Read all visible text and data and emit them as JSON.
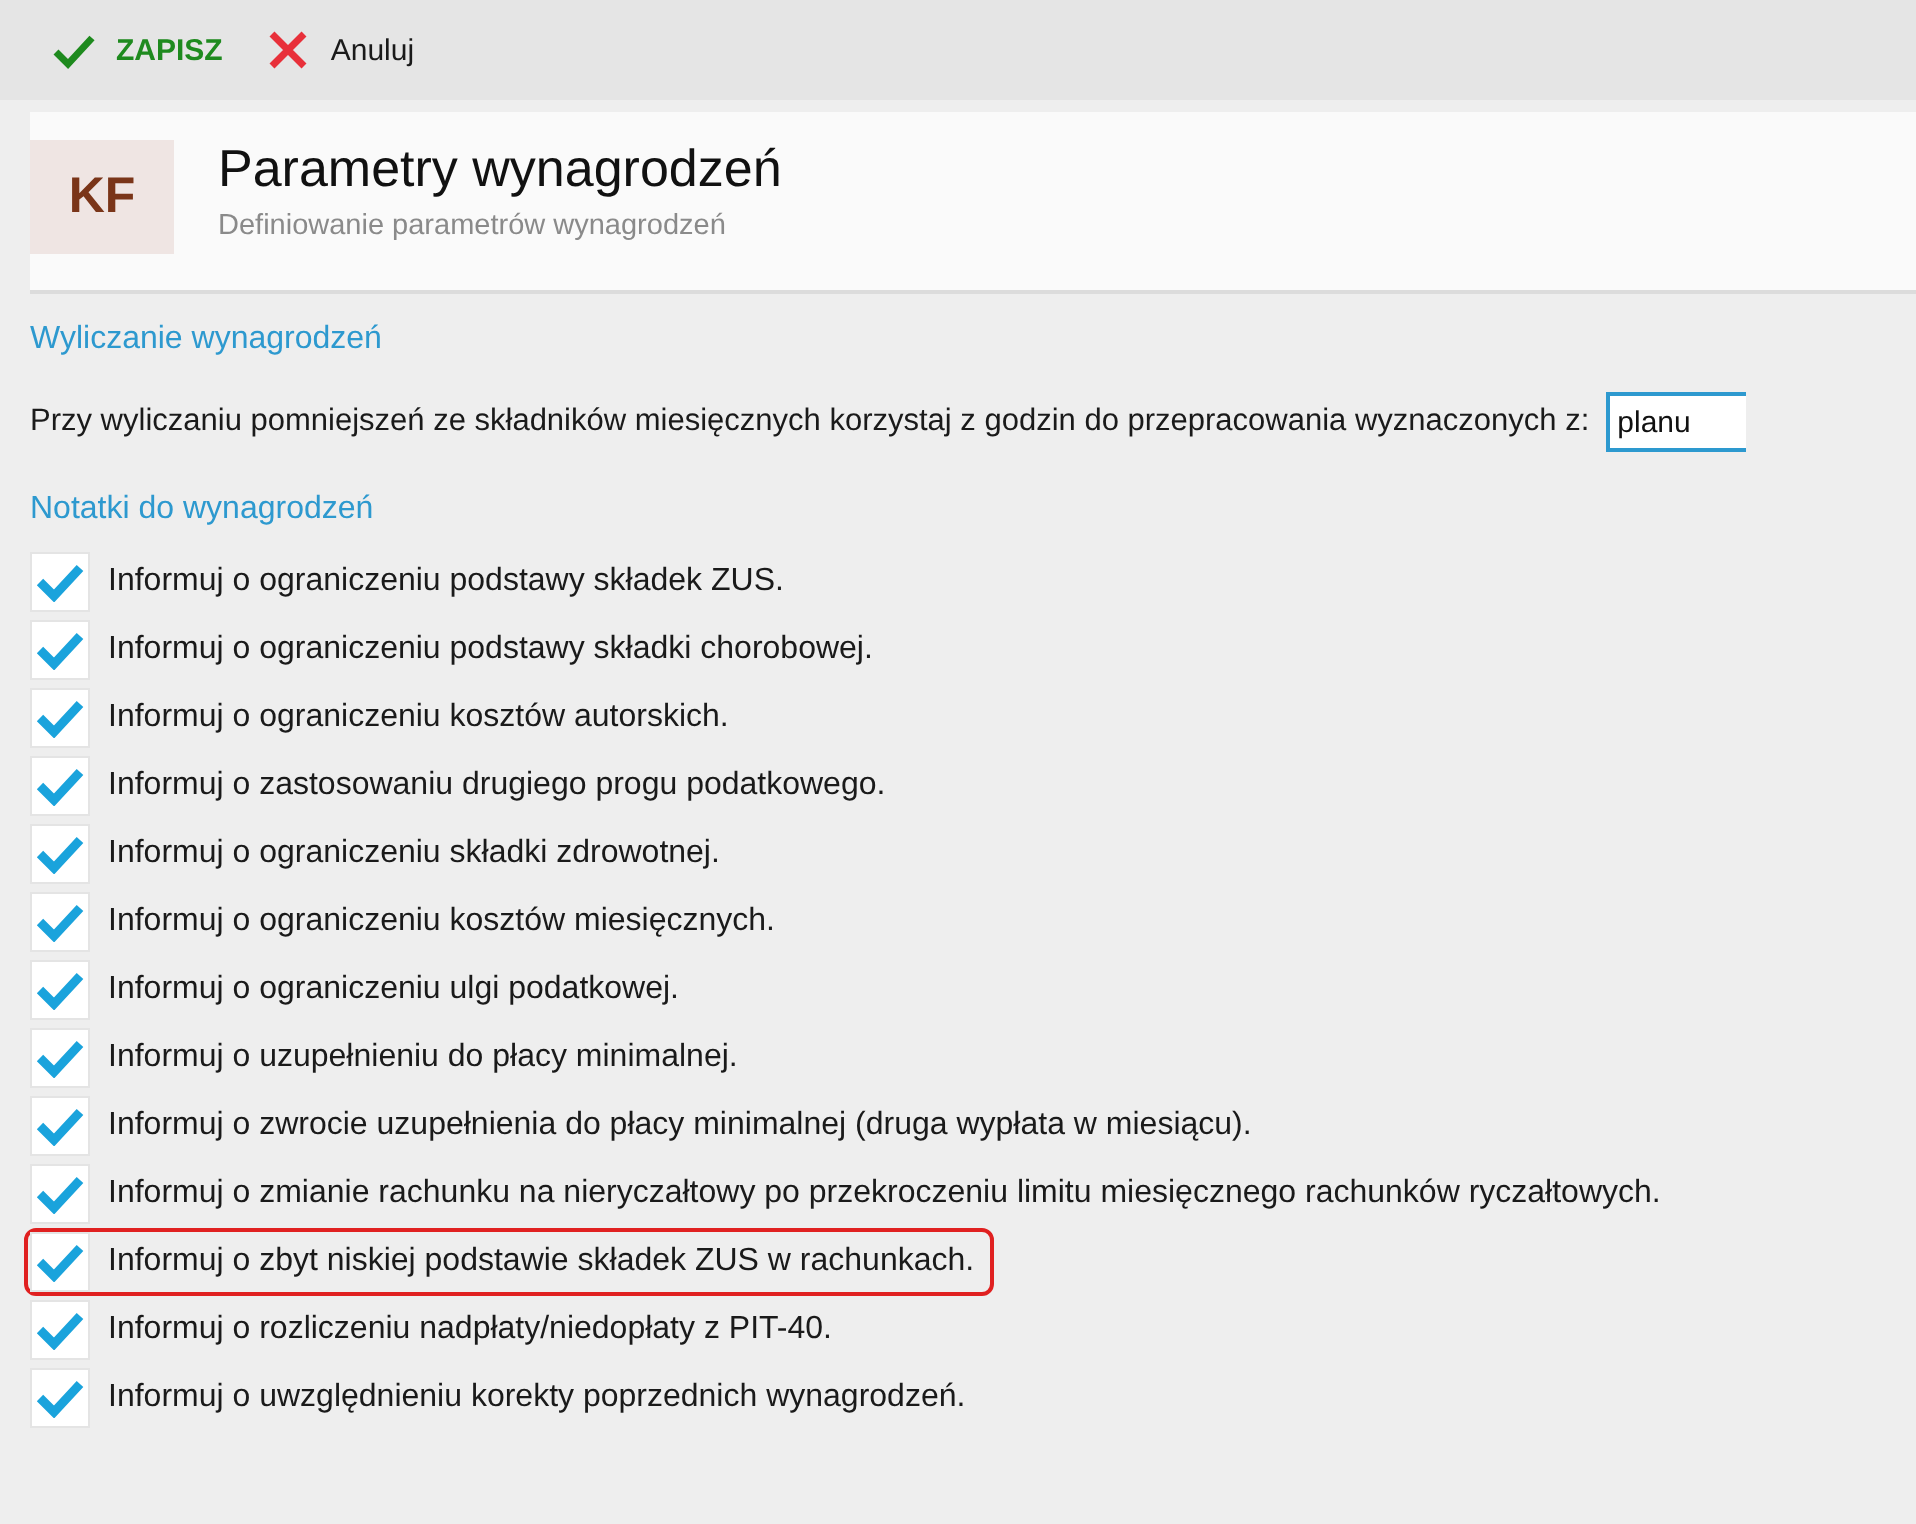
{
  "toolbar": {
    "save": "ZAPISZ",
    "cancel": "Anuluj"
  },
  "header": {
    "logo": "KF",
    "title": "Parametry wynagrodzeń",
    "subtitle": "Definiowanie parametrów wynagrodzeń"
  },
  "calculation": {
    "title": "Wyliczanie wynagrodzeń",
    "label": "Przy wyliczaniu pomniejszeń ze składników miesięcznych korzystaj z godzin do przepracowania wyznaczonych z:",
    "value": "planu"
  },
  "notes": {
    "title": "Notatki do wynagrodzeń",
    "items": [
      {
        "label": "Informuj o ograniczeniu podstawy składek ZUS.",
        "checked": true,
        "highlighted": false
      },
      {
        "label": "Informuj o ograniczeniu podstawy składki chorobowej.",
        "checked": true,
        "highlighted": false
      },
      {
        "label": "Informuj o ograniczeniu kosztów autorskich.",
        "checked": true,
        "highlighted": false
      },
      {
        "label": "Informuj o zastosowaniu drugiego progu podatkowego.",
        "checked": true,
        "highlighted": false
      },
      {
        "label": "Informuj o ograniczeniu składki zdrowotnej.",
        "checked": true,
        "highlighted": false
      },
      {
        "label": "Informuj o ograniczeniu kosztów miesięcznych.",
        "checked": true,
        "highlighted": false
      },
      {
        "label": "Informuj o ograniczeniu ulgi podatkowej.",
        "checked": true,
        "highlighted": false
      },
      {
        "label": "Informuj o uzupełnieniu do płacy minimalnej.",
        "checked": true,
        "highlighted": false
      },
      {
        "label": "Informuj o zwrocie uzupełnienia do płacy minimalnej (druga wypłata w miesiącu).",
        "checked": true,
        "highlighted": false
      },
      {
        "label": "Informuj o zmianie rachunku na nieryczałtowy po przekroczeniu limitu miesięcznego rachunków ryczałtowych.",
        "checked": true,
        "highlighted": false
      },
      {
        "label": "Informuj o zbyt niskiej podstawie składek ZUS w rachunkach.",
        "checked": true,
        "highlighted": true
      },
      {
        "label": "Informuj o rozliczeniu nadpłaty/niedopłaty z PIT-40.",
        "checked": true,
        "highlighted": false
      },
      {
        "label": "Informuj o uwzględnieniu korekty poprzednich wynagrodzeń.",
        "checked": true,
        "highlighted": false
      }
    ]
  }
}
